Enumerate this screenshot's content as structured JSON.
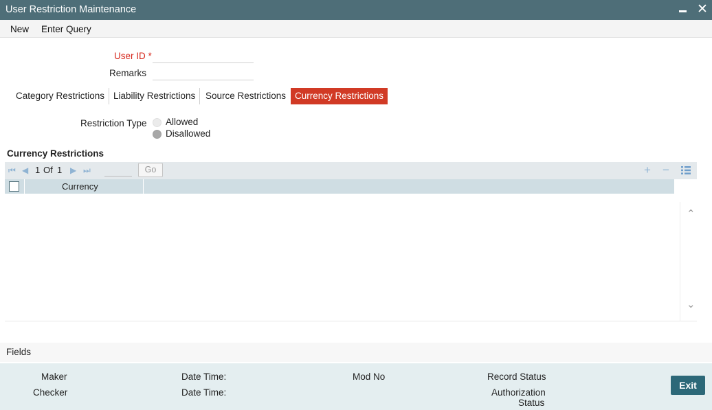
{
  "window": {
    "title": "User Restriction Maintenance",
    "minimize_glyph": "",
    "close_glyph": "✕"
  },
  "menu": {
    "items": [
      "New",
      "Enter Query"
    ]
  },
  "form": {
    "user_id_label": "User ID",
    "required_mark": "*",
    "user_id_value": "",
    "remarks_label": "Remarks",
    "remarks_value": ""
  },
  "tabs": [
    {
      "label": "Category Restrictions",
      "active": false
    },
    {
      "label": "Liability Restrictions",
      "active": false
    },
    {
      "label": "Source Restrictions",
      "active": false
    },
    {
      "label": "Currency Restrictions",
      "active": true
    }
  ],
  "restriction_type": {
    "label": "Restriction Type",
    "options": [
      {
        "label": "Allowed",
        "selected": false
      },
      {
        "label": "Disallowed",
        "selected": true
      }
    ]
  },
  "currency_section": {
    "title": "Currency Restrictions",
    "pager": {
      "current": "1",
      "of_label": "Of",
      "total": "1",
      "go_label": "Go",
      "first_icon": "first-page-icon",
      "prev_icon": "prev-page-icon",
      "next_icon": "next-page-icon",
      "last_icon": "last-page-icon"
    },
    "toolbar_icons": [
      "add-row-icon",
      "delete-row-icon",
      "single-view-icon"
    ],
    "columns": [
      "Currency"
    ],
    "rows": []
  },
  "fields_bar": {
    "label": "Fields"
  },
  "footer": {
    "maker": "Maker",
    "checker": "Checker",
    "date_time_1": "Date Time:",
    "date_time_2": "Date Time:",
    "mod_no": "Mod No",
    "record_status": "Record Status",
    "authorization_status_line1": "Authorization",
    "authorization_status_line2": "Status",
    "exit_label": "Exit"
  },
  "colors": {
    "titlebar": "#4e6e78",
    "active_tab": "#d13a25",
    "required": "#d6281d",
    "grid_header": "#cfdde3",
    "footer": "#e4eef0",
    "exit_button": "#2c6878",
    "toolbar_icon": "#8fb3d3"
  }
}
